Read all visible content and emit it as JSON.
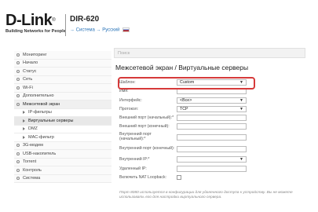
{
  "header": {
    "logo": "D-Link",
    "tagline": "Building Networks for People",
    "model": "DIR-620",
    "breadcrumb_sep": "→",
    "breadcrumb_system": "Система",
    "breadcrumb_lang": "Русский"
  },
  "search": {
    "placeholder": "Поиск"
  },
  "sidebar": {
    "items": [
      {
        "label": "Мониторинг"
      },
      {
        "label": "Начало"
      },
      {
        "label": "Статус"
      },
      {
        "label": "Сеть"
      },
      {
        "label": "Wi-Fi"
      },
      {
        "label": "Дополнительно"
      },
      {
        "label": "Межсетевой экран"
      },
      {
        "label": "IP-фильтры"
      },
      {
        "label": "Виртуальные серверы"
      },
      {
        "label": "DMZ"
      },
      {
        "label": "MAC-фильтр"
      },
      {
        "label": "3G-модем"
      },
      {
        "label": "USB-накопитель"
      },
      {
        "label": "Torrent"
      },
      {
        "label": "Контроль"
      },
      {
        "label": "Система"
      }
    ]
  },
  "main": {
    "title": "Межсетевой экран / Виртуальные серверы",
    "form": {
      "template_label": "Шаблон:",
      "template_value": "Custom",
      "name_label": "Имя:",
      "interface_label": "Интерфейс:",
      "interface_value": "<Все>",
      "protocol_label": "Протокол:",
      "protocol_value": "TCP",
      "ext_port_start_label": "Внешний порт (начальный):*",
      "ext_port_end_label": "Внешний порт (конечный):",
      "int_port_start_label": "Внутренний порт (начальный):*",
      "int_port_end_label": "Внутренний порт (конечный):",
      "internal_ip_label": "Внутренний IP:*",
      "remote_ip_label": "Удаленный IP:",
      "nat_loopback_label": "Включить NAT Loopback:"
    },
    "note": "Порт 8080 используется в конфигурации для удаленного доступа к устройству. Вы не можете использовать его для настройки виртуального сервера."
  }
}
